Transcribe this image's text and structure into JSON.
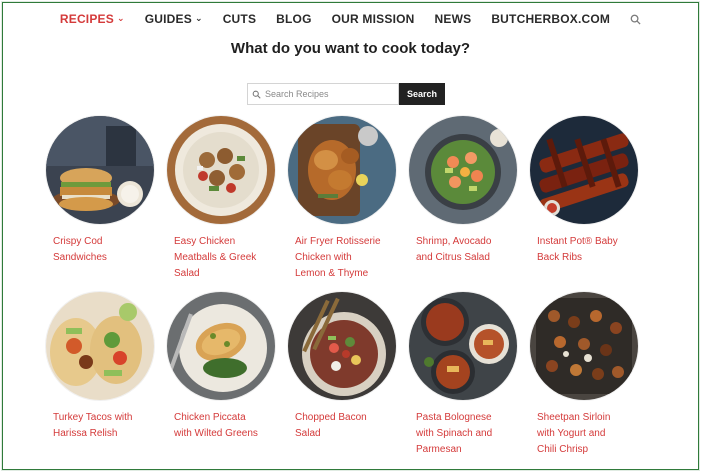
{
  "nav": {
    "items": [
      {
        "label": "RECIPES",
        "has_caret": true,
        "active": true
      },
      {
        "label": "GUIDES",
        "has_caret": true,
        "active": false
      },
      {
        "label": "CUTS",
        "has_caret": false,
        "active": false
      },
      {
        "label": "BLOG",
        "has_caret": false,
        "active": false
      },
      {
        "label": "OUR MISSION",
        "has_caret": false,
        "active": false
      },
      {
        "label": "NEWS",
        "has_caret": false,
        "active": false
      },
      {
        "label": "BUTCHERBOX.COM",
        "has_caret": false,
        "active": false
      }
    ],
    "search_icon": "search-icon"
  },
  "heading": "What do you want to cook today?",
  "search": {
    "placeholder": "Search Recipes",
    "value": "",
    "button_label": "Search"
  },
  "colors": {
    "accent": "#d43a3a",
    "button_bg": "#222222",
    "frame": "#2f7a3a"
  },
  "recipes": [
    {
      "title": "Crispy Cod\nSandwiches",
      "image": "cod-sandwich"
    },
    {
      "title": "Easy Chicken\nMeatballs & Greek\nSalad",
      "image": "chicken-meatballs"
    },
    {
      "title": "Air Fryer Rotisserie\nChicken with\nLemon & Thyme",
      "image": "rotisserie-chicken"
    },
    {
      "title": "Shrimp, Avocado\nand Citrus Salad",
      "image": "shrimp-salad"
    },
    {
      "title": "Instant Pot® Baby\nBack Ribs",
      "image": "baby-back-ribs"
    },
    {
      "title": "Turkey Tacos with\nHarissa Relish",
      "image": "turkey-tacos"
    },
    {
      "title": "Chicken Piccata\nwith Wilted Greens",
      "image": "chicken-piccata"
    },
    {
      "title": "Chopped Bacon\nSalad",
      "image": "bacon-salad"
    },
    {
      "title": "Pasta Bolognese\nwith Spinach and\nParmesan",
      "image": "pasta-bolognese"
    },
    {
      "title": "Sheetpan Sirloin\nwith Yogurt and\nChili Chrisp",
      "image": "sheetpan-sirloin"
    }
  ]
}
